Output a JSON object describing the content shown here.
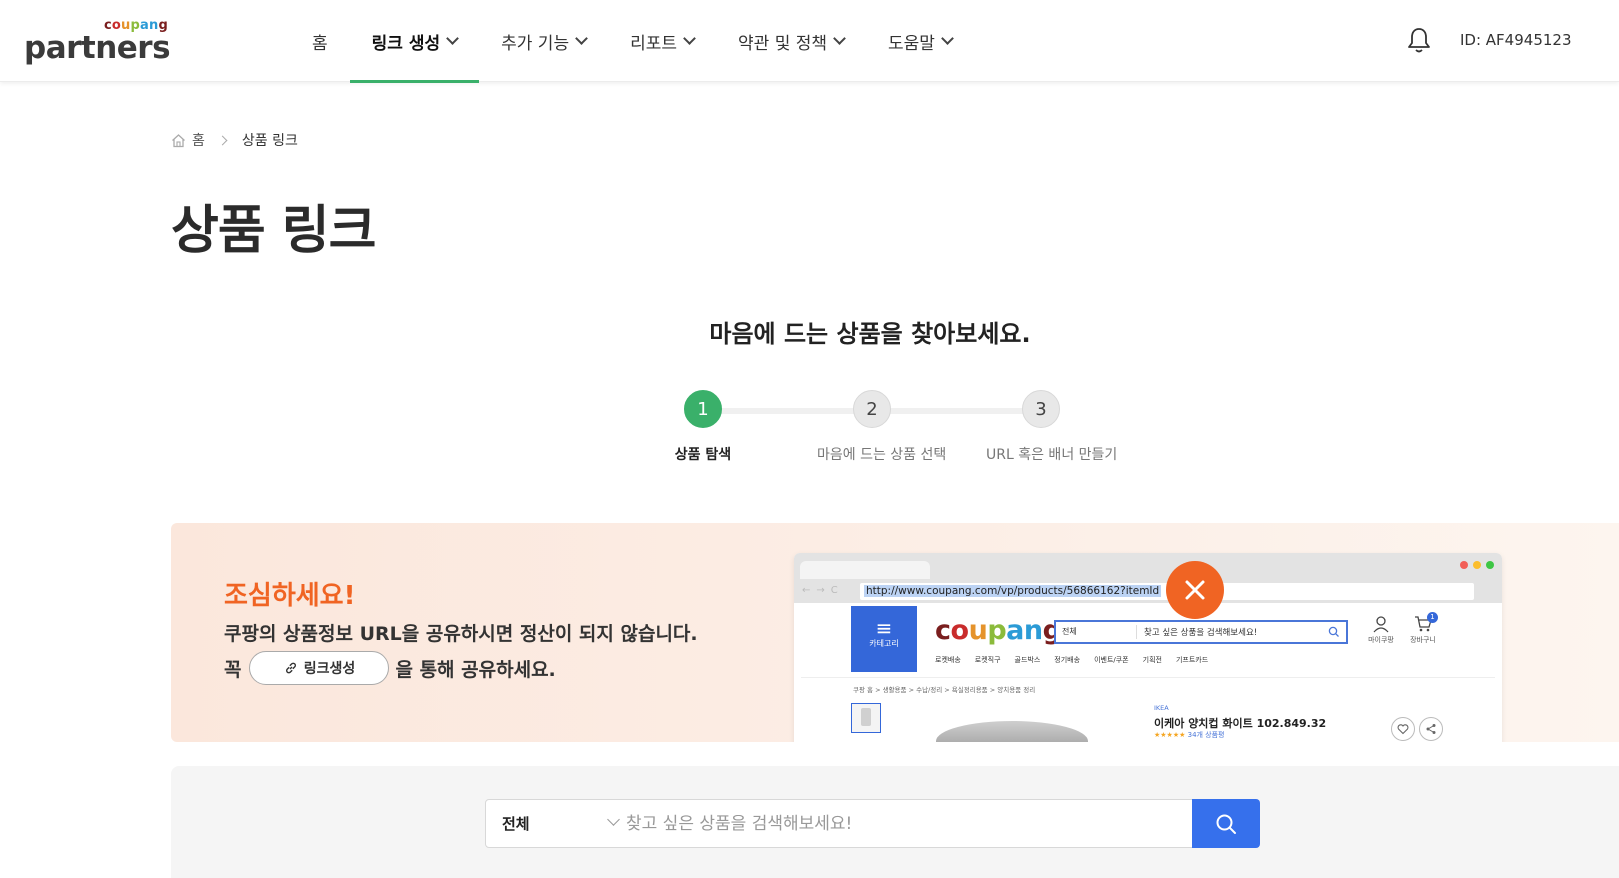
{
  "header": {
    "logo_small": "coupang",
    "logo_big": "partners",
    "nav": [
      {
        "label": "홈",
        "has_dropdown": false,
        "active": false
      },
      {
        "label": "링크 생성",
        "has_dropdown": true,
        "active": true
      },
      {
        "label": "추가 기능",
        "has_dropdown": true,
        "active": false
      },
      {
        "label": "리포트",
        "has_dropdown": true,
        "active": false
      },
      {
        "label": "약관 및 정책",
        "has_dropdown": true,
        "active": false
      },
      {
        "label": "도움말",
        "has_dropdown": true,
        "active": false
      }
    ],
    "bell_icon": "bell-icon",
    "user_id": "ID: AF4945123"
  },
  "breadcrumb": {
    "home": "홈",
    "current": "상품 링크"
  },
  "page_title": "상품 링크",
  "subtitle": "마음에 드는 상품을 찾아보세요.",
  "steps": [
    {
      "number": "1",
      "label": "상품 탐색",
      "active": true
    },
    {
      "number": "2",
      "label": "마음에 드는 상품 선택",
      "active": false
    },
    {
      "number": "3",
      "label": "URL 혹은 배너 만들기",
      "active": false
    }
  ],
  "warning": {
    "title": "조심하세요!",
    "line1": "쿠팡의 상품정보 URL을 공유하시면 정산이 되지 않습니다.",
    "line2_prefix": "꼭",
    "button_label": "링크생성",
    "line2_suffix": "을 통해 공유하세요.",
    "mock": {
      "url": "http://www.coupang.com/vp/products/56866162?itemId",
      "category_label": "카테고리",
      "logo": "coupang",
      "search_category": "전체",
      "search_placeholder": "찾고 싶은 상품을 검색해보세요!",
      "my_label": "마이쿠팡",
      "cart_label": "장바구니",
      "cart_count": "1",
      "menu": [
        "로켓배송",
        "로켓직구",
        "골드박스",
        "정기배송",
        "이벤트/쿠폰",
        "기획전",
        "기프트카드"
      ],
      "breadcrumb": "쿠팡 홈  >  생활용품  >  수납/정리  >  욕실정리용품  >  양치용품 정리",
      "brand": "IKEA",
      "product_name": "이케아 양치컵 화이트 102.849.32",
      "review_count": "34개 상품평"
    }
  },
  "search": {
    "category": "전체",
    "placeholder": "찾고 싶은 상품을 검색해보세요!",
    "value": ""
  },
  "colors": {
    "accent_green": "#3ab06a",
    "warning_orange": "#f06423",
    "search_blue": "#3670ec"
  }
}
